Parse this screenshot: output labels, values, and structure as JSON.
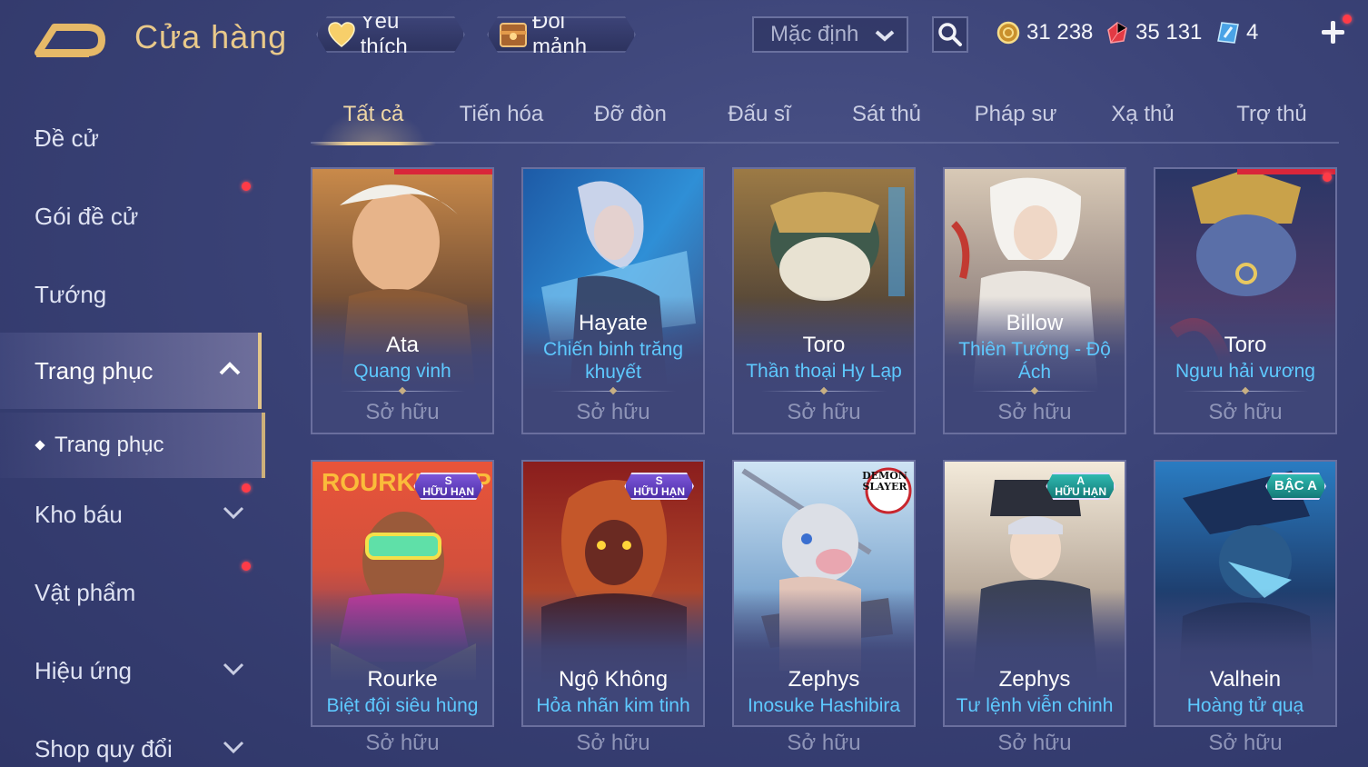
{
  "header": {
    "title": "Cửa hàng",
    "favorites_label": "Yêu thích",
    "exchange_label": "Đổi mảnh",
    "sort_value": "Mặc định",
    "currencies": {
      "gold": "31 238",
      "voucher": "35 131",
      "ticket": "4"
    }
  },
  "sidebar": {
    "items": [
      {
        "label": "Đề cử"
      },
      {
        "label": "Gói đề cử"
      },
      {
        "label": "Tướng"
      },
      {
        "label": "Trang phục"
      },
      {
        "label": "Trang phục"
      },
      {
        "label": "Kho báu"
      },
      {
        "label": "Vật phẩm"
      },
      {
        "label": "Hiệu ứng"
      },
      {
        "label": "Shop quy đổi"
      }
    ]
  },
  "tabs": [
    "Tất cả",
    "Tiến hóa",
    "Đỡ đòn",
    "Đấu sĩ",
    "Sát thủ",
    "Pháp sư",
    "Xạ thủ",
    "Trợ thủ"
  ],
  "cards": [
    {
      "hero": "Ata",
      "skin": "Quang vinh",
      "status": "Sở hữu"
    },
    {
      "hero": "Hayate",
      "skin": "Chiến binh trăng khuyết",
      "status": "Sở hữu"
    },
    {
      "hero": "Toro",
      "skin": "Thần thoại Hy Lạp",
      "status": "Sở hữu"
    },
    {
      "hero": "Billow",
      "skin": "Thiên Tướng - Độ Ách",
      "status": "Sở hữu"
    },
    {
      "hero": "Toro",
      "skin": "Ngưu hải vương",
      "status": "Sở hữu"
    },
    {
      "hero": "Rourke",
      "skin": "Biệt đội siêu hùng",
      "status": "Sở hữu",
      "badge_top": "S",
      "badge_bottom": "HỮU HẠN",
      "art_text": "ROURKE SUPERTEAM"
    },
    {
      "hero": "Ngộ Không",
      "skin": "Hỏa nhãn kim tinh",
      "status": "Sở hữu",
      "badge_top": "S",
      "badge_bottom": "HỮU HẠN"
    },
    {
      "hero": "Zephys",
      "skin": "Inosuke Hashibira",
      "status": "Sở hữu",
      "logo_text": "DEMON SLAYER"
    },
    {
      "hero": "Zephys",
      "skin": "Tư lệnh viễn chinh",
      "status": "Sở hữu",
      "badge_top": "A",
      "badge_bottom": "HỮU HẠN"
    },
    {
      "hero": "Valhein",
      "skin": "Hoàng tử quạ",
      "status": "Sở hữu",
      "badge_top": "BẬC A"
    }
  ],
  "colors": {
    "accent_gold": "#e9c98a",
    "skin_name_blue": "#5ec9ff",
    "notification_red": "#ff3b47",
    "badge_purple": "#6a45c8",
    "badge_teal": "#23a39b"
  },
  "icons": [
    "back-arrow-icon",
    "heart-icon",
    "shard-chest-icon",
    "chevron-down-icon",
    "search-icon",
    "gold-coin-icon",
    "voucher-gem-icon",
    "ticket-icon",
    "plus-icon",
    "chevron-up-icon"
  ]
}
